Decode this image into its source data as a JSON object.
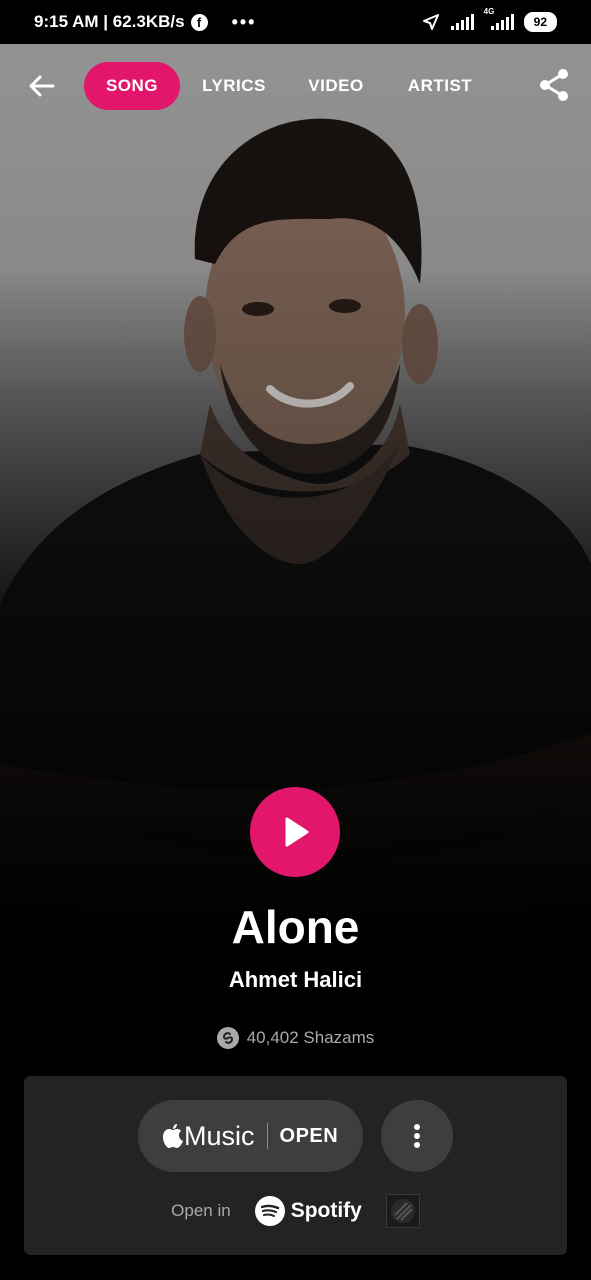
{
  "status_bar": {
    "time_speed": "9:15 AM | 62.3KB/s",
    "fb_glyph": "f",
    "more": "•••",
    "network_label": "4G",
    "battery": "92"
  },
  "nav": {
    "tabs": [
      "SONG",
      "LYRICS",
      "VIDEO",
      "ARTIST"
    ],
    "active_tab": "SONG"
  },
  "track": {
    "title": "Alone",
    "artist": "Ahmet Halici",
    "shazam_count": "40,402 Shazams"
  },
  "providers": {
    "apple_music_label": "Music",
    "apple_music_action": "OPEN",
    "open_in_label": "Open in",
    "spotify_label": "Spotify"
  },
  "colors": {
    "accent": "#e2166b",
    "panel": "#232323",
    "button": "#3e3e3e"
  },
  "icons": [
    "arrow-left-icon",
    "share-icon",
    "play-icon",
    "shazam-icon",
    "apple-icon",
    "more-vertical-icon",
    "spotify-icon",
    "deezer-icon",
    "location-arrow-icon",
    "signal-icon"
  ]
}
